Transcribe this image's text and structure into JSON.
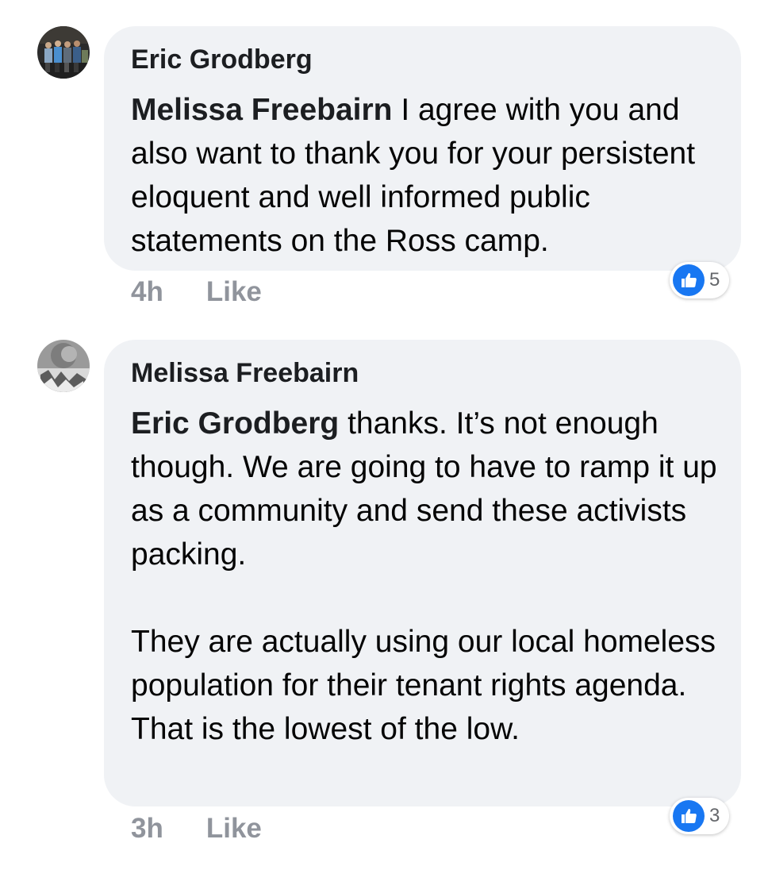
{
  "comments": [
    {
      "author": "Eric Grodberg",
      "mention": "Melissa Freebairn",
      "paragraphs": [
        " I agree with you and also want to thank you for your persistent eloquent and well informed public statements on the Ross camp."
      ],
      "time": "4h",
      "like_label": "Like",
      "reaction_icon": "like-icon",
      "reaction_count": "5"
    },
    {
      "author": "Melissa Freebairn",
      "mention": "Eric Grodberg",
      "paragraphs": [
        " thanks. It’s not enough though. We are going to have to ramp it up as a community and send these activists packing.",
        "They are actually using our local homeless population for their tenant rights agenda. That is the lowest of the low."
      ],
      "time": "3h",
      "like_label": "Like",
      "reaction_icon": "like-icon",
      "reaction_count": "3"
    }
  ],
  "colors": {
    "bubble": "#f0f2f5",
    "meta": "#90949c",
    "like_blue": "#1877f2"
  }
}
